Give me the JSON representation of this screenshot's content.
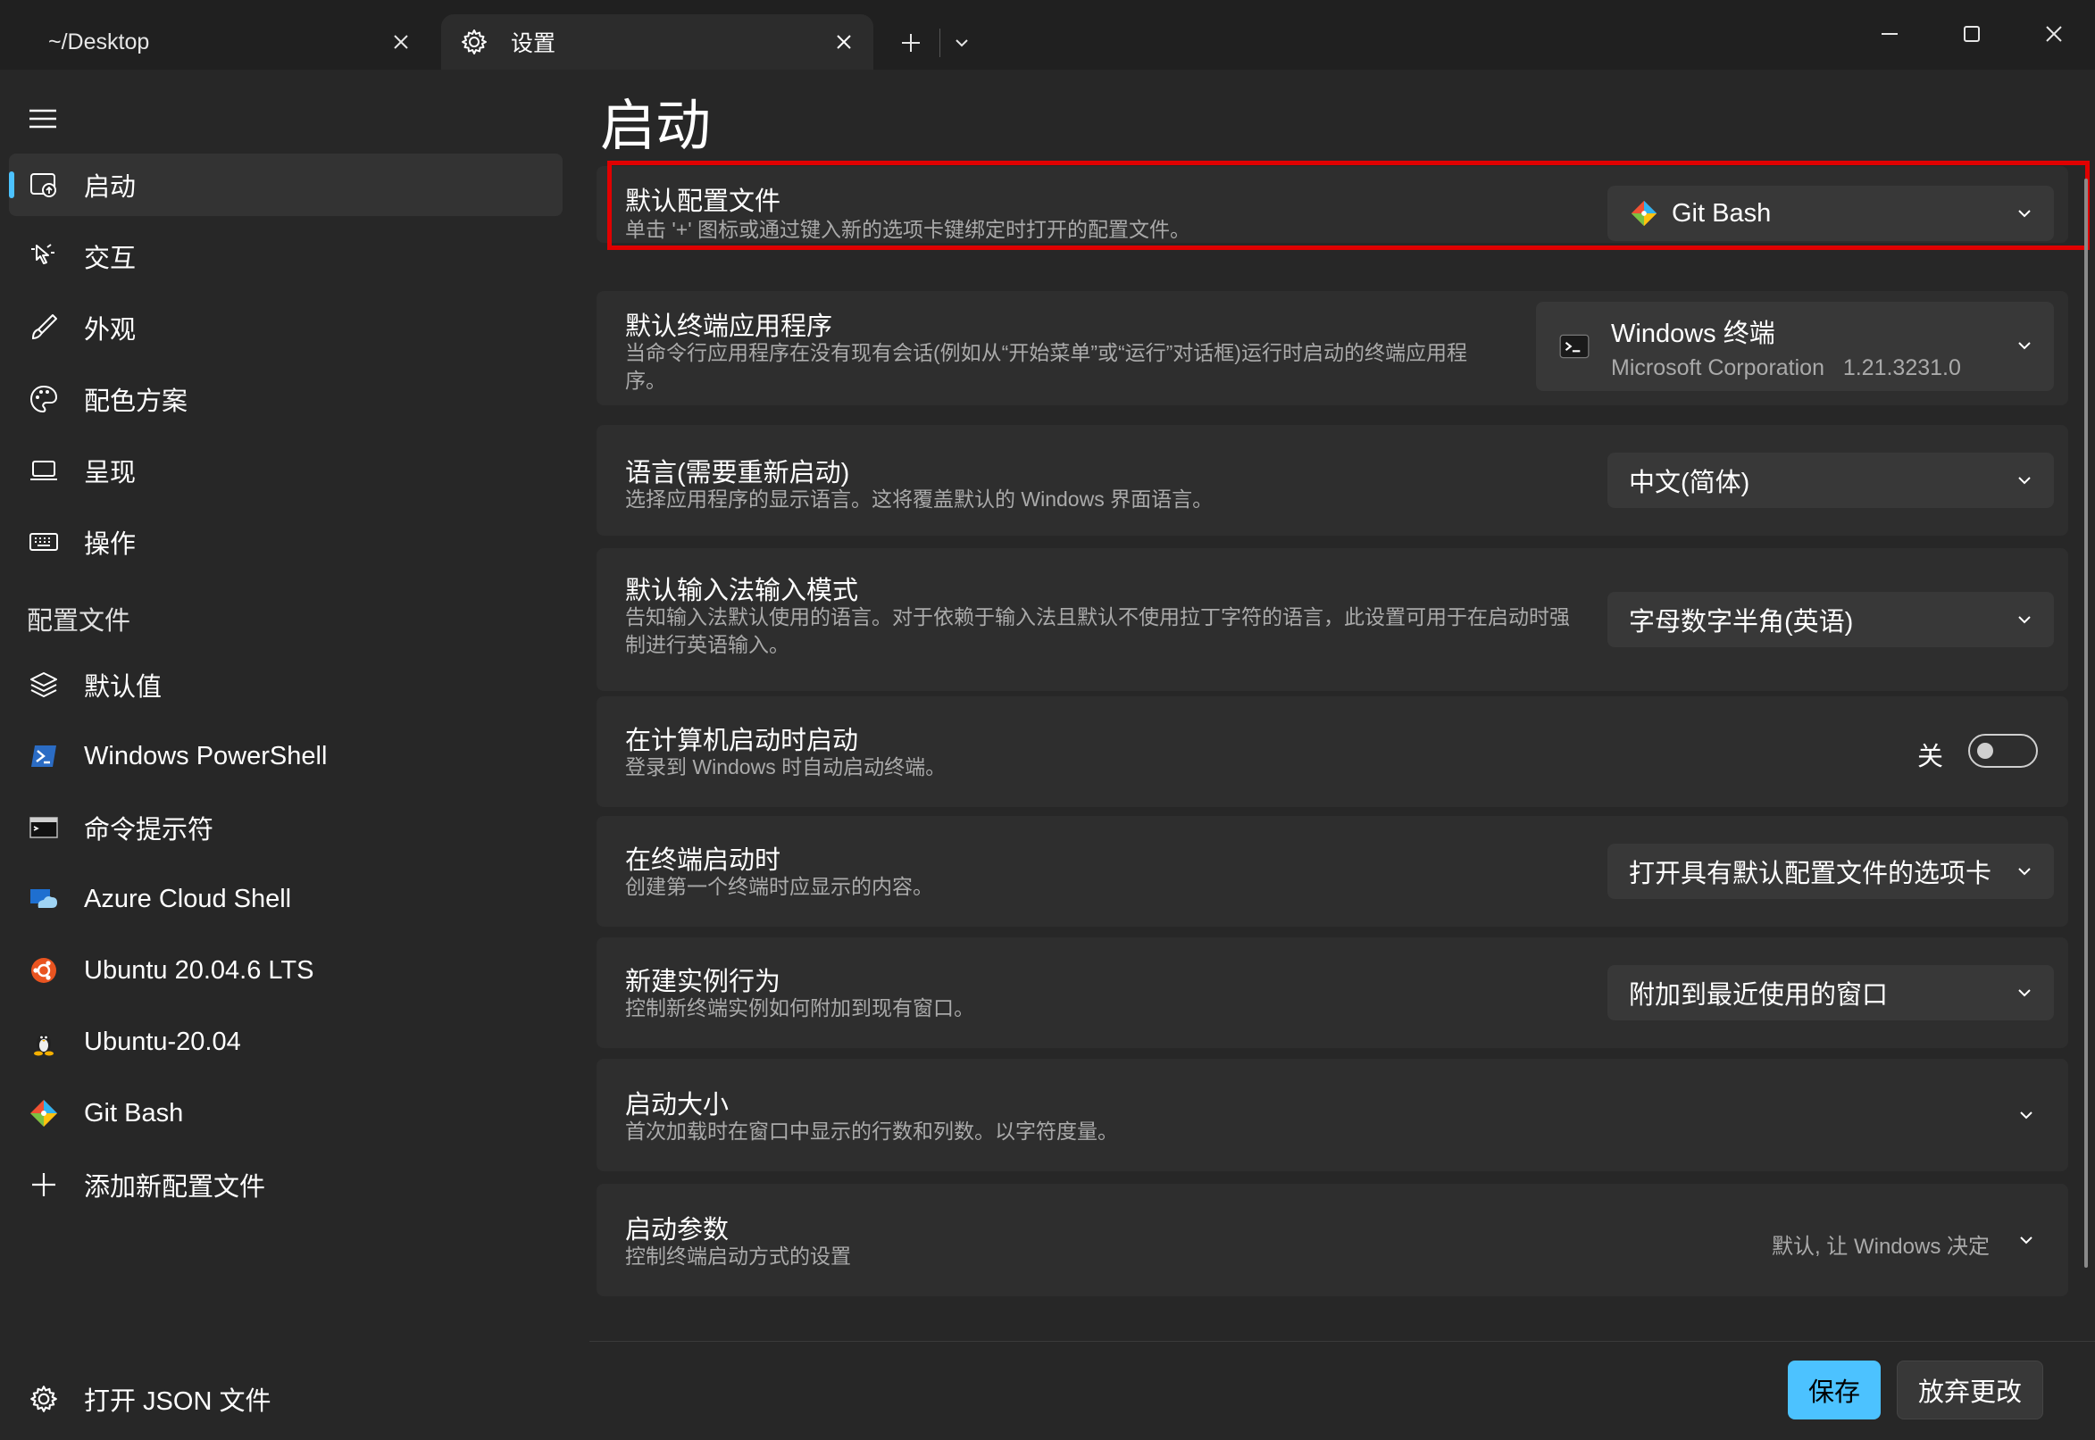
{
  "tabs": [
    {
      "label": "~/Desktop",
      "active": false
    },
    {
      "label": "设置",
      "active": true
    }
  ],
  "titlebar": {
    "new_tab": "+",
    "dropdown_icon": "chevron-down-icon"
  },
  "sidebar": {
    "items": [
      {
        "label": "启动",
        "icon": "launch-icon",
        "selected": true
      },
      {
        "label": "交互",
        "icon": "interaction-icon"
      },
      {
        "label": "外观",
        "icon": "brush-icon"
      },
      {
        "label": "配色方案",
        "icon": "palette-icon"
      },
      {
        "label": "呈现",
        "icon": "monitor-icon"
      },
      {
        "label": "操作",
        "icon": "keyboard-icon"
      }
    ],
    "section_label": "配置文件",
    "profiles": [
      {
        "label": "默认值",
        "icon": "layers-icon"
      },
      {
        "label": "Windows PowerShell",
        "icon": "powershell-icon"
      },
      {
        "label": "命令提示符",
        "icon": "cmd-icon"
      },
      {
        "label": "Azure Cloud Shell",
        "icon": "azure-icon"
      },
      {
        "label": "Ubuntu 20.04.6 LTS",
        "icon": "ubuntu-icon"
      },
      {
        "label": "Ubuntu-20.04",
        "icon": "linux-icon"
      },
      {
        "label": "Git Bash",
        "icon": "git-icon"
      },
      {
        "label": "添加新配置文件",
        "icon": "plus-icon"
      }
    ],
    "open_json": "打开 JSON 文件"
  },
  "main": {
    "title": "启动",
    "settings": [
      {
        "title": "默认配置文件",
        "desc": "单击 '+' 图标或通过键入新的选项卡键绑定时打开的配置文件。",
        "value": "Git Bash"
      },
      {
        "title": "默认终端应用程序",
        "desc": "当命令行应用程序在没有现有会话(例如从“开始菜单”或“运行”对话框)运行时启动的终端应用程序。",
        "value": "Windows 终端",
        "value_sub": "Microsoft Corporation",
        "value_version": "1.21.3231.0"
      },
      {
        "title": "语言(需要重新启动)",
        "desc": "选择应用程序的显示语言。这将覆盖默认的 Windows 界面语言。",
        "value": "中文(简体)"
      },
      {
        "title": "默认输入法输入模式",
        "desc": "告知输入法默认使用的语言。对于依赖于输入法且默认不使用拉丁字符的语言，此设置可用于在启动时强制进行英语输入。",
        "value": "字母数字半角(英语)"
      },
      {
        "title": "在计算机启动时启动",
        "desc": "登录到 Windows 时自动启动终端。",
        "toggle_label": "关",
        "toggle_on": false
      },
      {
        "title": "在终端启动时",
        "desc": "创建第一个终端时应显示的内容。",
        "value": "打开具有默认配置文件的选项卡"
      },
      {
        "title": "新建实例行为",
        "desc": "控制新终端实例如何附加到现有窗口。",
        "value": "附加到最近使用的窗口"
      },
      {
        "title": "启动大小",
        "desc": "首次加载时在窗口中显示的行数和列数。以字符度量。"
      },
      {
        "title": "启动参数",
        "desc": "控制终端启动方式的设置",
        "value": "默认, 让 Windows 决定"
      }
    ]
  },
  "footer": {
    "save": "保存",
    "discard": "放弃更改"
  },
  "colors": {
    "accent": "#4cc2ff",
    "highlight": "#e00000",
    "background": "#272727",
    "card": "#2e2e2e"
  }
}
